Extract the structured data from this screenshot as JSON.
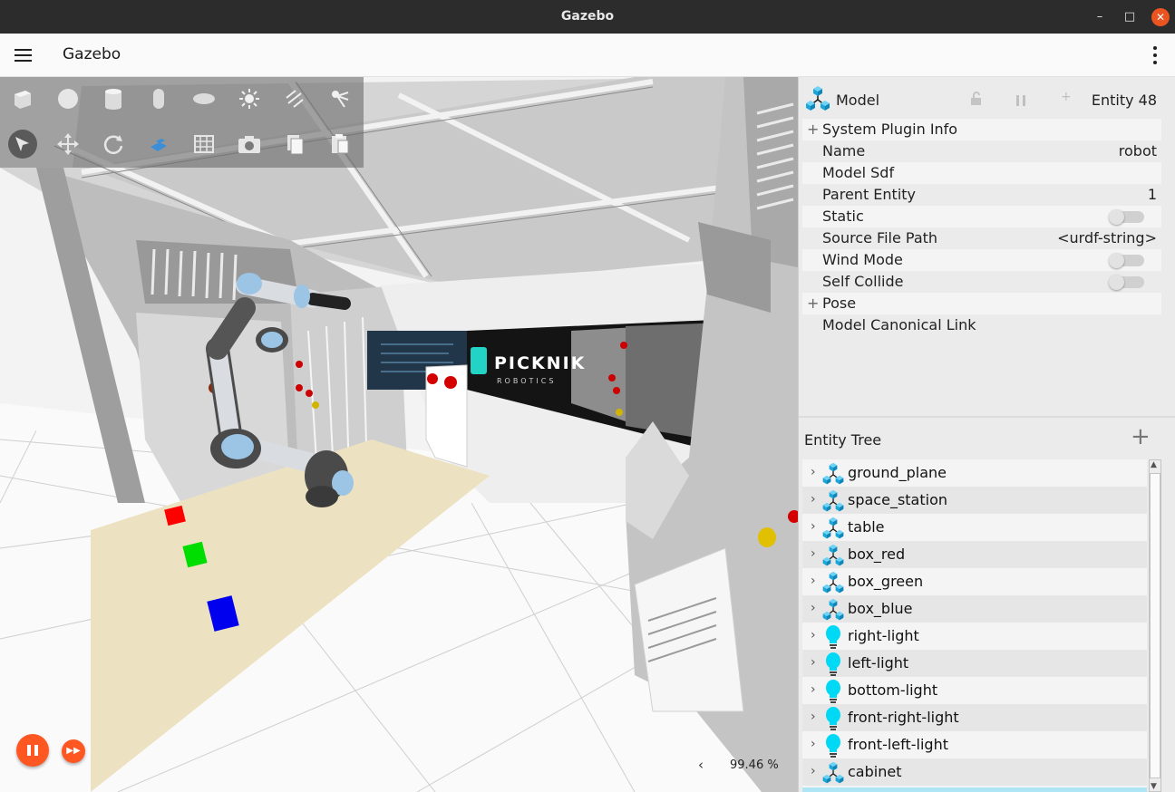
{
  "window": {
    "title": "Gazebo",
    "minimize": "–",
    "maximize": "□",
    "close": "✕"
  },
  "appbar": {
    "title": "Gazebo"
  },
  "toolbar": {
    "row1": [
      "box-icon",
      "sphere-icon",
      "cylinder-icon",
      "capsule-icon",
      "ellipsoid-icon",
      "point-light-icon",
      "directional-light-icon",
      "spot-light-icon"
    ],
    "row2": [
      "select-icon",
      "translate-icon",
      "rotate-icon",
      "transform-snap-icon",
      "grid-icon",
      "screenshot-icon",
      "copy-icon",
      "paste-icon"
    ]
  },
  "scene": {
    "rtf_arrow": "‹",
    "rtf_value": "99.46 %",
    "step_glyph": "▶▶",
    "logo_text": "PICKNIK",
    "logo_sub": "ROBOTICS"
  },
  "component_inspector": {
    "type": "Model",
    "entity": "Entity 48",
    "rows": [
      {
        "expand": "+",
        "label": "System Plugin Info",
        "value": ""
      },
      {
        "expand": "",
        "label": "Name",
        "value": "robot"
      },
      {
        "expand": "",
        "label": "Model Sdf",
        "value": ""
      },
      {
        "expand": "",
        "label": "Parent Entity",
        "value": "1"
      },
      {
        "expand": "",
        "label": "Static",
        "value": ""
      },
      {
        "expand": "",
        "label": "Source File Path",
        "value": "<urdf-string>"
      },
      {
        "expand": "",
        "label": "Wind Mode",
        "value": ""
      },
      {
        "expand": "",
        "label": "Self Collide",
        "value": ""
      },
      {
        "expand": "+",
        "label": "Pose",
        "value": ""
      },
      {
        "expand": "",
        "label": "Model Canonical Link",
        "value": ""
      }
    ],
    "toggles": {
      "static": false,
      "wind_mode": false,
      "self_collide": false
    }
  },
  "entity_tree": {
    "title": "Entity Tree",
    "add": "+",
    "items": [
      {
        "label": "ground_plane",
        "icon": "model-icon"
      },
      {
        "label": "space_station",
        "icon": "model-icon"
      },
      {
        "label": "table",
        "icon": "model-icon"
      },
      {
        "label": "box_red",
        "icon": "model-icon"
      },
      {
        "label": "box_green",
        "icon": "model-icon"
      },
      {
        "label": "box_blue",
        "icon": "model-icon"
      },
      {
        "label": "right-light",
        "icon": "light-icon"
      },
      {
        "label": "left-light",
        "icon": "light-icon"
      },
      {
        "label": "bottom-light",
        "icon": "light-icon"
      },
      {
        "label": "front-right-light",
        "icon": "light-icon"
      },
      {
        "label": "front-left-light",
        "icon": "light-icon"
      },
      {
        "label": "cabinet",
        "icon": "model-icon"
      }
    ]
  },
  "colors": {
    "accent": "#ff5722",
    "entity_icon": "#1aa6d8",
    "light_icon": "#00d9f5",
    "selected": "#aee6f5"
  }
}
